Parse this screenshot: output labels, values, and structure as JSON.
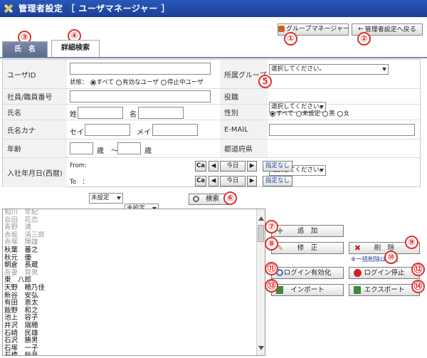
{
  "header": {
    "title": "管理者設定 ［ ユーザマネージャー ］"
  },
  "toolbar": {
    "group_manager": "グループマネージャー",
    "back": "管理者設定へ戻る"
  },
  "tabs": [
    "氏　名",
    "詳細検索"
  ],
  "badges": [
    "①",
    "②",
    "③",
    "④",
    "5",
    "⑥",
    "⑦",
    "⑧",
    "⑨",
    "⑩",
    "⑪",
    "⑫",
    "⑬",
    "⑭"
  ],
  "form": {
    "userid_label": "ユーザID",
    "status_label": "状態：",
    "status_options": [
      "すべて",
      "有効なユーザ",
      "停止中ユーザ"
    ],
    "group_label": "所属グループ",
    "group_select": "選択してください。",
    "empno_label": "社員/職員番号",
    "position_label": "役職",
    "position_select": "選択してください。",
    "name_label": "氏名",
    "sei": "姓",
    "mei": "名",
    "gender_label": "性別",
    "gender_options": [
      "すべて",
      "未設定",
      "男",
      "女"
    ],
    "kana_label": "氏名カナ",
    "sei_kana": "セイ",
    "mei_kana": "メイ",
    "email_label": "E-MAIL",
    "age_label": "年齢",
    "age_unit1": "歳　～",
    "age_unit2": "歳",
    "pref_label": "都道府県",
    "pref_select": "選択してください。",
    "joined_label": "入社年月日(西暦)",
    "from_label": "From:",
    "to_label": "To　：",
    "unset": "未設定",
    "cal": "Ca",
    "prev": "◀",
    "today": "今日",
    "next": "▶",
    "none": "指定なし"
  },
  "search_button": "検索",
  "users": [
    {
      "name": "相川　年紀",
      "active": false
    },
    {
      "name": "会田　花恋",
      "active": false
    },
    {
      "name": "青野　満",
      "active": false
    },
    {
      "name": "赤坂　清三郎",
      "active": false
    },
    {
      "name": "赤塚　陣雄",
      "active": false
    },
    {
      "name": "秋葉　蕃之",
      "active": true
    },
    {
      "name": "秋元　優",
      "active": true
    },
    {
      "name": "朝倉　長蔵",
      "active": true
    },
    {
      "name": "吾妻　育男",
      "active": false
    },
    {
      "name": "東　八郎",
      "active": true
    },
    {
      "name": "天野　穂乃佳",
      "active": true
    },
    {
      "name": "新谷　安弘",
      "active": true
    },
    {
      "name": "有田　恵太",
      "active": true
    },
    {
      "name": "飯野　和之",
      "active": true
    },
    {
      "name": "池上　容子",
      "active": true
    },
    {
      "name": "井沢　瑞穂",
      "active": true
    },
    {
      "name": "石崎　民雄",
      "active": true
    },
    {
      "name": "石沢　勝男",
      "active": true
    },
    {
      "name": "石塚　一子",
      "active": true
    },
    {
      "name": "石橋　鈴音",
      "active": true
    }
  ],
  "actions": {
    "add": "追　加",
    "edit": "修　正",
    "delete": "削　除",
    "bulk_note": "※一括削除は可能",
    "enable": "ログイン有効化",
    "stop": "ログイン停止",
    "import": "インポート",
    "export": "エクスポート"
  },
  "colors": {
    "header": "#1a3e96",
    "badge": "#e03030",
    "tab_active": "#5a6a8a"
  }
}
